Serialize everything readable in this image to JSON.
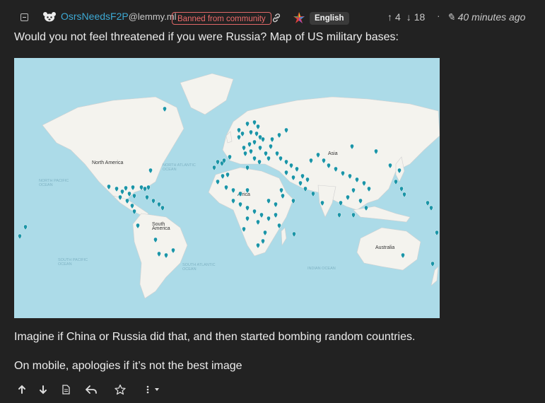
{
  "post": {
    "username": "OsrsNeedsF2P",
    "instance": "@lemmy.ml",
    "banned_badge": "Banned from community",
    "language": "English",
    "upvotes": "4",
    "downvotes": "18",
    "separator": "·",
    "time": "40 minutes ago",
    "title": "Would you not feel threatened if you were Russia? Map of US military bases:",
    "body_line1": "Imagine if China or Russia did that, and then started bombing random countries.",
    "body_line2": "On mobile, apologies if it’s not the best image"
  },
  "map": {
    "labels": {
      "north_america": "North America",
      "north_atlantic": "NORTH ATLANTIC\nOCEAN",
      "north_pacific": "NORTH PACIFIC\nOCEAN",
      "asia": "Asia",
      "africa": "Africa",
      "south_america": "South\nAmerica",
      "south_pacific": "SOUTH PACIFIC\nOCEAN",
      "south_atlantic": "SOUTH ATLANTIC\nOCEAN",
      "indian_ocean": "INDIAN OCEAN",
      "australia": "Australia"
    },
    "colors": {
      "ocean": "#acdbe8",
      "land": "#f4f3ee",
      "marker": "#1b95a7"
    }
  },
  "actions": [
    "upvote-icon",
    "downvote-icon",
    "view-source-icon",
    "reply-icon",
    "save-star-icon",
    "more-options-icon"
  ]
}
